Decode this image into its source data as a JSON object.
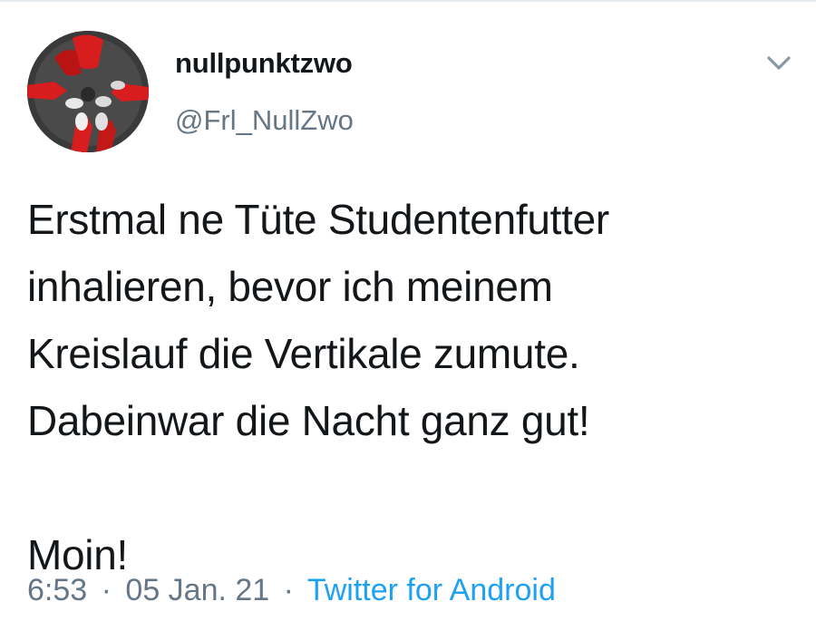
{
  "tweet": {
    "display_name": "nullpunktzwo",
    "handle": "@Frl_NullZwo",
    "text_lines": [
      "Erstmal ne Tüte Studentenfutter",
      "inhalieren, bevor ich meinem",
      "Kreislauf die Vertikale zumute.",
      "Dabeinwar die Nacht ganz gut!",
      "",
      "Moin!"
    ],
    "time": "6:53",
    "separator": "·",
    "date": "05 Jan. 21",
    "source": "Twitter for Android"
  },
  "icons": {
    "menu": "chevron-down-icon",
    "avatar": "avatar-image"
  },
  "colors": {
    "text": "#14171a",
    "secondary": "#657786",
    "link": "#1da1f2",
    "avatar_accent": "#d71d1d"
  }
}
